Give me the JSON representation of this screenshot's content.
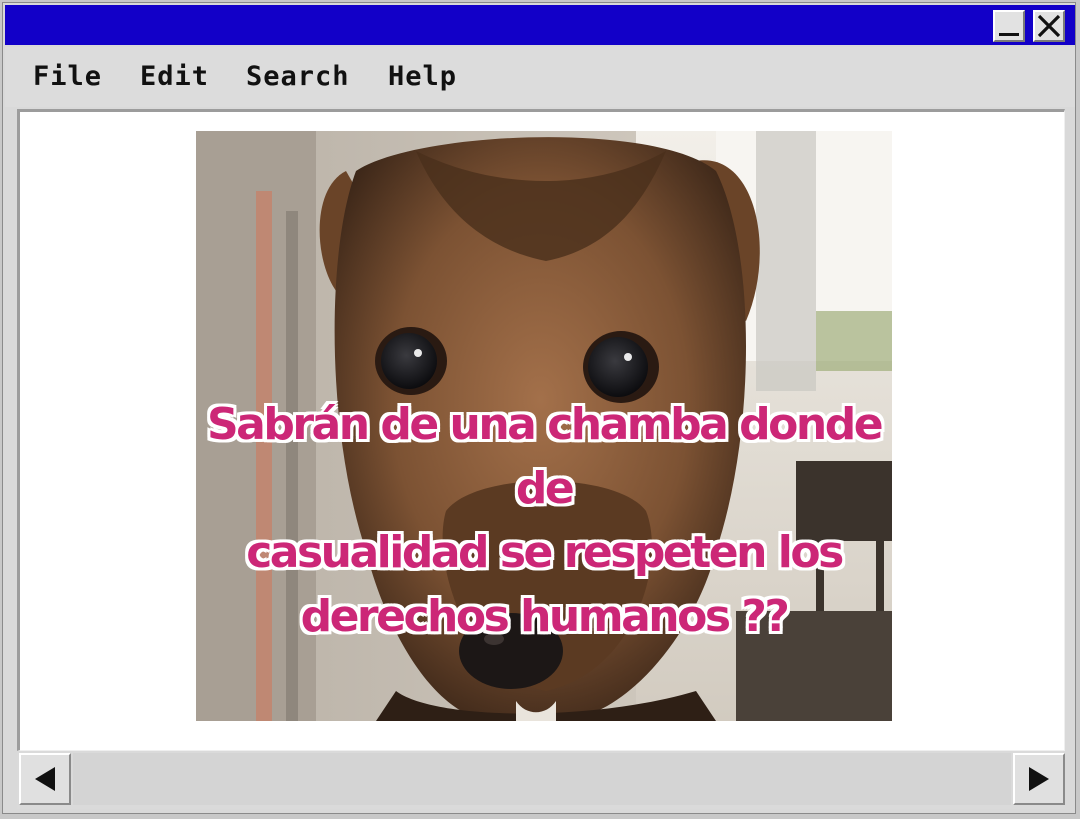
{
  "window": {
    "minimize_icon": "minimize-icon",
    "close_icon": "close-icon",
    "titlebar_color": "#1200c8"
  },
  "menu": {
    "items": [
      "File",
      "Edit",
      "Search",
      "Help"
    ]
  },
  "content": {
    "image": {
      "subject": "dog",
      "caption_lines": [
        "Sabrán de una chamba donde de",
        "casualidad se  respeten los",
        "derechos humanos ??"
      ],
      "caption_color": "#cc2777"
    }
  },
  "scrollbar": {
    "left_icon": "arrow-left-icon",
    "right_icon": "arrow-right-icon"
  }
}
